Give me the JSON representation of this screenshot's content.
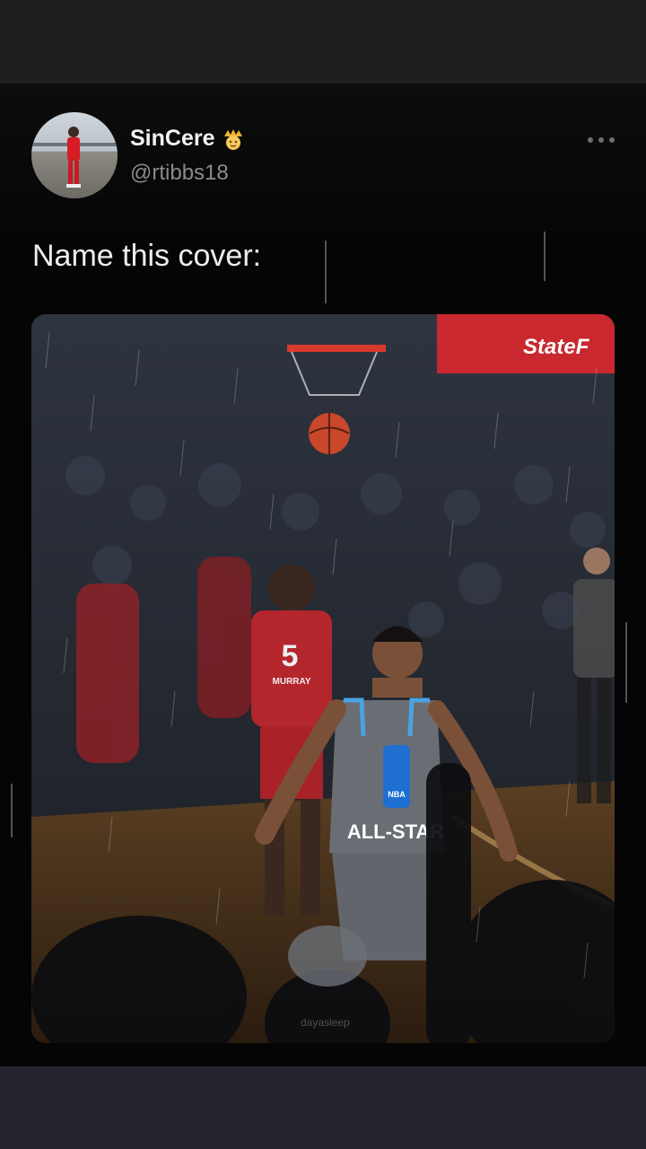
{
  "post": {
    "display_name": "SinCere",
    "handle": "@rtibbs18",
    "text": "Name this cover:",
    "verified_emoji": "crown-prince-emoji"
  },
  "media": {
    "sign_text": "StateF",
    "jersey_number": "5",
    "jersey_name": "MURRAY",
    "jersey_text": "ALL-STAR",
    "badge_text": "NBA",
    "watermark": "dayasleep"
  },
  "icons": {
    "more": "more-horizontal-icon"
  },
  "colors": {
    "background": "#050505",
    "name": "#f2f2f2",
    "handle": "#8b8b8b",
    "sign_red": "#c8282e"
  }
}
